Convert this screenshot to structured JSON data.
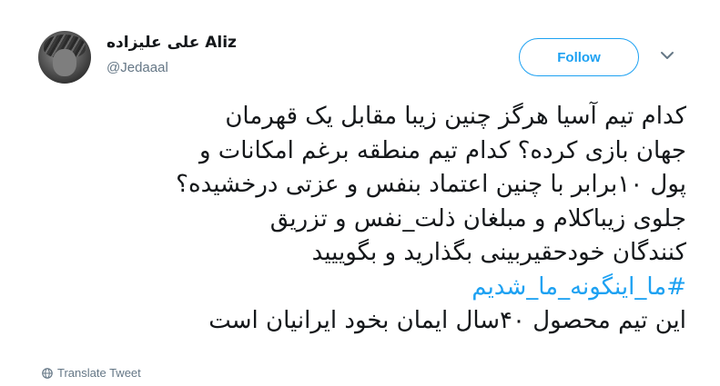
{
  "user": {
    "display_name": "علی علیزاده Aliz",
    "handle": "@Jedaaal"
  },
  "follow_label": "Follow",
  "tweet": {
    "lines": [
      "کدام تیم آسیا هرگز چنین زیبا مقابل یک قهرمان",
      "جهان بازی کرده؟ کدام تیم منطقه برغم امکانات و",
      "پول ۱۰برابر با چنین اعتماد بنفس و عزتی درخشیده؟",
      "جلوی زیباکلام و مبلغان ذلت_نفس و تزریق",
      "کنندگان خودحقیربینی بگذارید و بگوییید"
    ],
    "hashtag": "#ما_اینگونه_ما_شدیم",
    "last_line": "این تیم محصول ۴۰سال ایمان بخود ایرانیان است"
  },
  "translate_label": "Translate Tweet",
  "colors": {
    "accent": "#1da1f2",
    "secondary_text": "#657786",
    "text": "#14171a"
  },
  "icons": {
    "caret": "chevron-down-icon",
    "globe": "globe-icon"
  }
}
